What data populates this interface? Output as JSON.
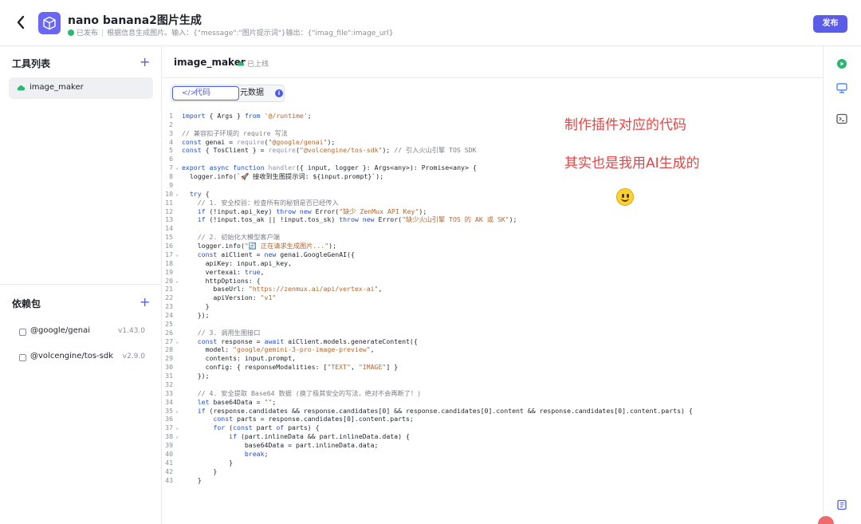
{
  "header": {
    "back_icon": "chevron-left-icon",
    "app_icon": "cube-icon",
    "title": "nano banana2图片生成",
    "status": "已发布",
    "description": "根据信息生成图片。输入：{\"message\":\"图片提示词\"}输出：{\"imag_file\":image_url}",
    "publish_label": "发布",
    "accent_color": "#5b5ce8"
  },
  "sidebar": {
    "tools_heading": "工具列表",
    "tools": [
      {
        "name": "image_maker",
        "icon": "cloud-icon"
      }
    ],
    "deps_heading": "依赖包",
    "deps": [
      {
        "name": "@google/genai",
        "version": "v1.43.0"
      },
      {
        "name": "@volcengine/tos-sdk",
        "version": "v2.9.0"
      }
    ]
  },
  "main": {
    "tool_name": "image_maker",
    "tool_status": "已上线",
    "tabs": [
      {
        "label": "代码",
        "icon": "code-icon",
        "active": true
      },
      {
        "label": "元数据",
        "icon": "metadata-icon",
        "active": false
      }
    ],
    "code_lines": [
      {
        "n": "1",
        "html": "import { Args } from '@/runtime';"
      },
      {
        "n": "2",
        "html": ""
      },
      {
        "n": "3",
        "html": "// 兼容扣子环境的 require 写法"
      },
      {
        "n": "4",
        "html": "const genai = require(\"@google/genai\");"
      },
      {
        "n": "5",
        "html": "const { TosClient } = require(\"@volcengine/tos-sdk\"); // 引入火山引擎 TOS SDK"
      },
      {
        "n": "6",
        "html": ""
      },
      {
        "n": "7",
        "html": "export async function handler({ input, logger }: Args<any>): Promise<any> {"
      },
      {
        "n": "8",
        "html": "  logger.info(`🚀 接收到生图提示词: ${input.prompt}`);"
      },
      {
        "n": "9",
        "html": ""
      },
      {
        "n": "10",
        "html": "  try {"
      },
      {
        "n": "11",
        "html": "    // 1. 安全校验：检查所有的秘钥是否已经传入"
      },
      {
        "n": "12",
        "html": "    if (!input.api_key) throw new Error(\"缺少 ZenMux API Key\");"
      },
      {
        "n": "13",
        "html": "    if (!input.tos_ak || !input.tos_sk) throw new Error(\"缺少火山引擎 TOS 的 AK 或 SK\");"
      },
      {
        "n": "14",
        "html": ""
      },
      {
        "n": "15",
        "html": "    // 2. 初始化大模型客户端"
      },
      {
        "n": "16",
        "html": "    logger.info(\"🔄 正在请求生成图片...\");"
      },
      {
        "n": "17",
        "html": "    const aiClient = new genai.GoogleGenAI({"
      },
      {
        "n": "18",
        "html": "      apiKey: input.api_key,"
      },
      {
        "n": "19",
        "html": "      vertexai: true,"
      },
      {
        "n": "20",
        "html": "      httpOptions: {"
      },
      {
        "n": "21",
        "html": "        baseUrl: \"https://zenmux.ai/api/vertex-ai\","
      },
      {
        "n": "22",
        "html": "        apiVersion: \"v1\""
      },
      {
        "n": "23",
        "html": "      }"
      },
      {
        "n": "24",
        "html": "    });"
      },
      {
        "n": "25",
        "html": ""
      },
      {
        "n": "26",
        "html": "    // 3. 调用生图接口"
      },
      {
        "n": "27",
        "html": "    const response = await aiClient.models.generateContent({"
      },
      {
        "n": "28",
        "html": "      model: \"google/gemini-3-pro-image-preview\","
      },
      {
        "n": "29",
        "html": "      contents: input.prompt,"
      },
      {
        "n": "30",
        "html": "      config: { responseModalities: [\"TEXT\", \"IMAGE\"] }"
      },
      {
        "n": "31",
        "html": "    });"
      },
      {
        "n": "32",
        "html": ""
      },
      {
        "n": "33",
        "html": "    // 4. 安全提取 Base64 数据 (换了极其安全的写法，绝对不会再断了！)"
      },
      {
        "n": "34",
        "html": "    let base64Data = \"\";"
      },
      {
        "n": "35",
        "html": "    if (response.candidates && response.candidates[0] && response.candidates[0].content && response.candidates[0].content.parts) {"
      },
      {
        "n": "36",
        "html": "        const parts = response.candidates[0].content.parts;"
      },
      {
        "n": "37",
        "html": "        for (const part of parts) {"
      },
      {
        "n": "38",
        "html": "            if (part.inlineData && part.inlineData.data) {"
      },
      {
        "n": "39",
        "html": "                base64Data = part.inlineData.data;"
      },
      {
        "n": "40",
        "html": "                break;"
      },
      {
        "n": "41",
        "html": "            }"
      },
      {
        "n": "42",
        "html": "        }"
      },
      {
        "n": "43",
        "html": "    }"
      }
    ]
  },
  "annotations": {
    "note1": "制作插件对应的代码",
    "note2": "其实也是我用AI生成的",
    "note_color": "#e54545",
    "emoji": "smiley-icon"
  },
  "rail": {
    "icons": [
      "debug-icon",
      "monitor-icon",
      "terminal-icon",
      "book-icon"
    ]
  }
}
